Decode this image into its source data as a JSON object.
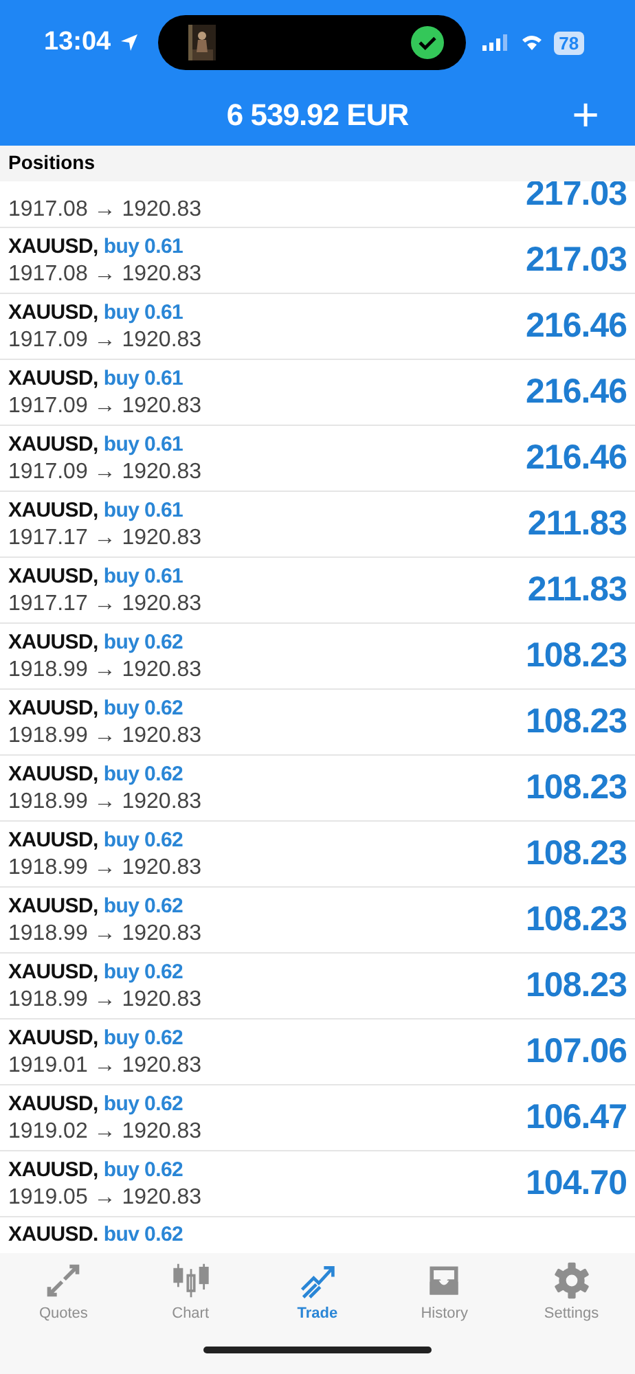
{
  "status_bar": {
    "time": "13:04",
    "battery": "78"
  },
  "header": {
    "balance": "6 539.92 EUR",
    "add": "+"
  },
  "section": {
    "title": "Positions"
  },
  "positions": [
    {
      "prices": "1917.08 → 1920.83",
      "profit": "217.03"
    },
    {
      "symbol": "XAUUSD,",
      "side": "buy 0.61",
      "prices": "1917.08 → 1920.83",
      "profit": "217.03"
    },
    {
      "symbol": "XAUUSD,",
      "side": "buy 0.61",
      "prices": "1917.09 → 1920.83",
      "profit": "216.46"
    },
    {
      "symbol": "XAUUSD,",
      "side": "buy 0.61",
      "prices": "1917.09 → 1920.83",
      "profit": "216.46"
    },
    {
      "symbol": "XAUUSD,",
      "side": "buy 0.61",
      "prices": "1917.09 → 1920.83",
      "profit": "216.46"
    },
    {
      "symbol": "XAUUSD,",
      "side": "buy 0.61",
      "prices": "1917.17 → 1920.83",
      "profit": "211.83"
    },
    {
      "symbol": "XAUUSD,",
      "side": "buy 0.61",
      "prices": "1917.17 → 1920.83",
      "profit": "211.83"
    },
    {
      "symbol": "XAUUSD,",
      "side": "buy 0.62",
      "prices": "1918.99 → 1920.83",
      "profit": "108.23"
    },
    {
      "symbol": "XAUUSD,",
      "side": "buy 0.62",
      "prices": "1918.99 → 1920.83",
      "profit": "108.23"
    },
    {
      "symbol": "XAUUSD,",
      "side": "buy 0.62",
      "prices": "1918.99 → 1920.83",
      "profit": "108.23"
    },
    {
      "symbol": "XAUUSD,",
      "side": "buy 0.62",
      "prices": "1918.99 → 1920.83",
      "profit": "108.23"
    },
    {
      "symbol": "XAUUSD,",
      "side": "buy 0.62",
      "prices": "1918.99 → 1920.83",
      "profit": "108.23"
    },
    {
      "symbol": "XAUUSD,",
      "side": "buy 0.62",
      "prices": "1918.99 → 1920.83",
      "profit": "108.23"
    },
    {
      "symbol": "XAUUSD,",
      "side": "buy 0.62",
      "prices": "1919.01 → 1920.83",
      "profit": "107.06"
    },
    {
      "symbol": "XAUUSD,",
      "side": "buy 0.62",
      "prices": "1919.02 → 1920.83",
      "profit": "106.47"
    },
    {
      "symbol": "XAUUSD,",
      "side": "buy 0.62",
      "prices": "1919.05 → 1920.83",
      "profit": "104.70"
    },
    {
      "symbol": "XAUUSD.",
      "side": "buv 0.62"
    }
  ],
  "tabs": [
    {
      "kind": "quotes",
      "label": "Quotes",
      "selected": false
    },
    {
      "kind": "chart",
      "label": "Chart",
      "selected": false
    },
    {
      "kind": "trade",
      "label": "Trade",
      "selected": true
    },
    {
      "kind": "history",
      "label": "History",
      "selected": false
    },
    {
      "kind": "settings",
      "label": "Settings",
      "selected": false
    }
  ]
}
